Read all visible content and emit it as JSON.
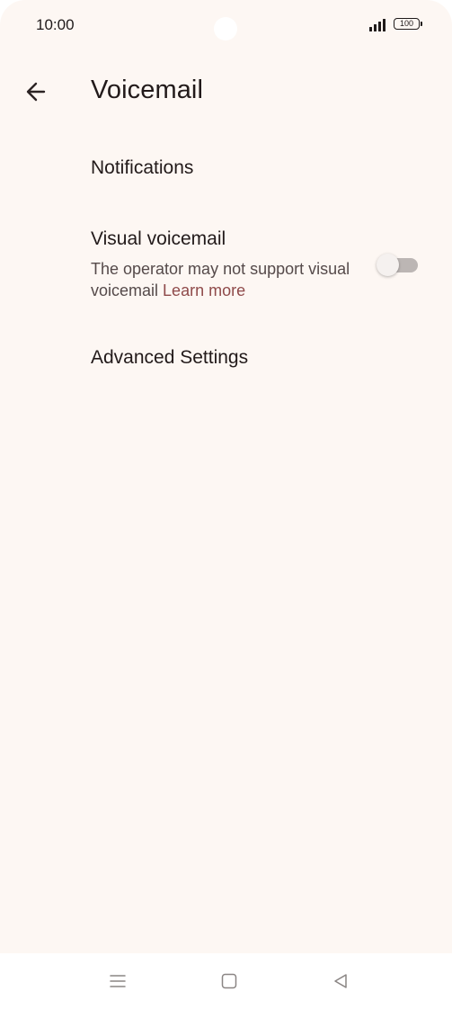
{
  "status_bar": {
    "time": "10:00",
    "battery": "100",
    "icons": [
      "signal-icon",
      "battery-icon"
    ]
  },
  "app_bar": {
    "back_icon": "arrow-left-icon",
    "title": "Voicemail"
  },
  "settings": {
    "notifications": {
      "title": "Notifications"
    },
    "visual_voicemail": {
      "title": "Visual voicemail",
      "summary": "The operator may not support visual voicemail",
      "link": "Learn more",
      "enabled": false
    },
    "advanced": {
      "title": "Advanced Settings"
    }
  },
  "nav_bar": {
    "icons": [
      "menu-icon",
      "home-icon",
      "back-triangle-icon"
    ]
  },
  "colors": {
    "background": "#fdf7f3",
    "text_primary": "#221a1a",
    "text_secondary": "#554a4a",
    "link": "#8f4a4a",
    "toggle_track_off": "#bcb6b4"
  }
}
